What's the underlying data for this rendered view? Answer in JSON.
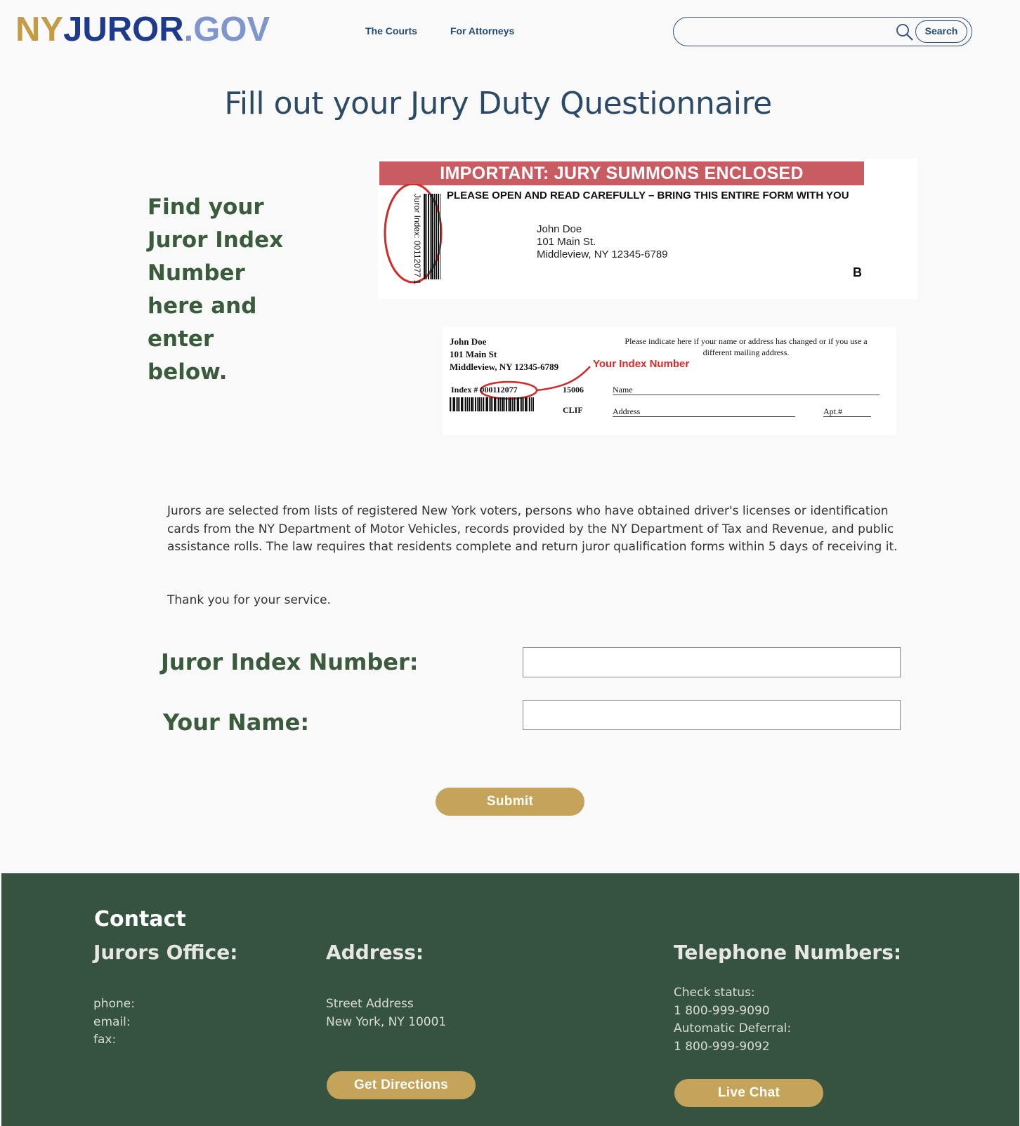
{
  "header": {
    "logo": {
      "part1": "NY",
      "part2": "JUROR",
      "part3": ".GOV"
    },
    "nav": [
      "The Courts",
      "For Attorneys"
    ],
    "search": {
      "placeholder": "",
      "button_label": "Search"
    }
  },
  "page_title": "Fill out your Jury Duty Questionnaire",
  "instructions": [
    "Find your",
    "Juror Index",
    "Number",
    "here and",
    "enter",
    "below."
  ],
  "summons_card": {
    "banner": "IMPORTANT: JURY SUMMONS ENCLOSED",
    "subheading": "PLEASE OPEN AND READ CAREFULLY – BRING THIS ENTIRE FORM WITH YOU",
    "address_lines": [
      "John Doe",
      "101 Main St.",
      "Middleview, NY 12345-6789"
    ],
    "code": "B",
    "barcode_label": "Juror Index: 00112077 1"
  },
  "return_card": {
    "address_lines": [
      "John Doe",
      "101 Main St",
      "Middleview, NY 12345-6789"
    ],
    "notice": "Please indicate here if your name or address has changed or if you use a different mailing address.",
    "callout": "Your Index Number",
    "index_label": "Index #",
    "index_value": "000112077",
    "code1": "15006",
    "code2": "CLIF",
    "name_field": "Name",
    "address_field": "Address",
    "apt_field": "Apt.#"
  },
  "description": "Jurors are selected from lists of registered New York voters, persons who have obtained driver's licenses or identification cards from the NY Department of Motor Vehicles, records provided by the NY Department of Tax and Revenue, and public assistance rolls. The law requires that residents complete and return juror qualification forms within 5 days of receiving it.",
  "thanks": "Thank you for your service.",
  "form": {
    "index_label": "Juror Index Number:",
    "index_value": "",
    "name_label": "Your Name:",
    "name_value": "",
    "submit_label": "Submit"
  },
  "footer": {
    "contact_title": "Contact",
    "office": {
      "heading": "Jurors Office:",
      "lines": [
        "phone:",
        "email:",
        "fax:"
      ]
    },
    "address": {
      "heading": "Address:",
      "lines": [
        "Street Address",
        "New York, NY 10001"
      ],
      "button_label": "Get Directions"
    },
    "telephone": {
      "heading": "Telephone Numbers:",
      "lines": [
        "Check status:",
        "1 800-999-9090",
        "Automatic Deferral:",
        "1 800-999-9092"
      ],
      "button_label": "Live Chat"
    }
  },
  "colors": {
    "accent_gold": "#c4a35a",
    "footer_green": "#365340",
    "heading_green": "#3a5c3c",
    "banner_red": "#c95c62",
    "callout_red": "#e02727"
  }
}
